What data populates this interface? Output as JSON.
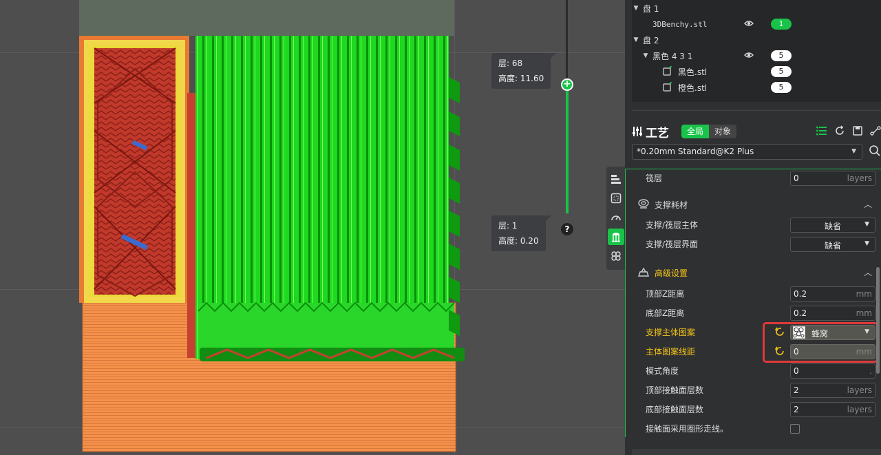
{
  "viewport": {
    "layer_top": {
      "layer_label": "层: 68",
      "height_label": "高度: 11.60"
    },
    "layer_bottom": {
      "layer_label": "层: 1",
      "height_label": "高度: 0.20"
    },
    "slider_handle_glyph": "+",
    "help_glyph": "?"
  },
  "side_tabs": [
    {
      "icon": "layers-icon"
    },
    {
      "icon": "frame-icon"
    },
    {
      "icon": "speed-icon"
    },
    {
      "icon": "support-icon",
      "active": true
    },
    {
      "icon": "clover-icon"
    }
  ],
  "objects": {
    "plates": [
      {
        "label": "盘 1",
        "items": [
          {
            "name": "3DBenchy.stl",
            "badge": "1",
            "badge_color": "#19c34a",
            "visible": true
          }
        ]
      },
      {
        "label": "盘 2",
        "group": {
          "name": "黑色 4 3 1",
          "badge": "5",
          "visible": true
        },
        "items": [
          {
            "name": "黑色.stl",
            "badge": "5"
          },
          {
            "name": "橙色.stl",
            "badge": "5"
          }
        ]
      }
    ]
  },
  "process": {
    "title": "工艺",
    "tabs": [
      {
        "label": "全局",
        "active": true
      },
      {
        "label": "对象",
        "active": false
      }
    ],
    "preset": "*0.20mm Standard@K2 Plus"
  },
  "settings": {
    "raft_layers": {
      "label": "筏层",
      "value": "0",
      "unit": "layers"
    },
    "support_filament": {
      "title": "支撑耗材",
      "body": {
        "label": "支撑/筏层主体",
        "value": "缺省"
      },
      "interface": {
        "label": "支撑/筏层界面",
        "value": "缺省"
      }
    },
    "advanced": {
      "title": "高级设置",
      "top_z": {
        "label": "顶部Z距离",
        "value": "0.2",
        "unit": "mm"
      },
      "bottom_z": {
        "label": "底部Z距离",
        "value": "0.2",
        "unit": "mm"
      },
      "base_pattern": {
        "label": "支撑主体图案",
        "value": "蜂窝"
      },
      "base_spacing": {
        "label": "主体图案线距",
        "value": "0",
        "unit": "mm"
      },
      "pattern_angle": {
        "label": "模式角度",
        "value": "0",
        "unit": "."
      },
      "top_interface_layers": {
        "label": "顶部接触面层数",
        "value": "2",
        "unit": "layers"
      },
      "bottom_interface_layers": {
        "label": "底部接触面层数",
        "value": "2",
        "unit": "layers"
      },
      "loop_pattern": {
        "label": "接触面采用圈形走线。",
        "checked": false
      }
    }
  },
  "colors": {
    "accent": "#19c34a",
    "highlight_label": "#f5c518",
    "highlight_box": "#e03a3a"
  }
}
